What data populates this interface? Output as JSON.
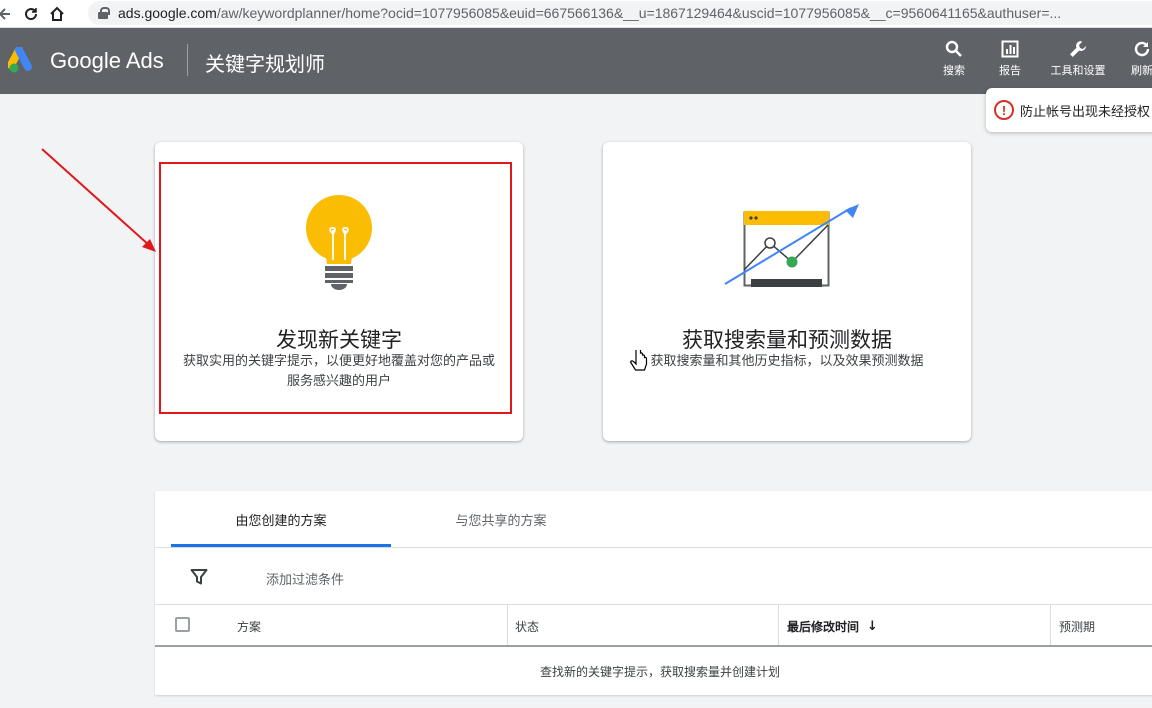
{
  "browser": {
    "url_host": "ads.google.com",
    "url_path": "/aw/keywordplanner/home?ocid=1077956085&euid=667566136&__u=1867129464&uscid=1077956085&__c=9560641165&authuser=..."
  },
  "header": {
    "brand": "Google Ads",
    "page_title": "关键字规划师",
    "actions": [
      {
        "label": "搜索",
        "icon": "search-icon"
      },
      {
        "label": "报告",
        "icon": "report-icon"
      },
      {
        "label": "工具和设置",
        "icon": "wrench-icon"
      },
      {
        "label": "刷新",
        "icon": "refresh-icon"
      }
    ]
  },
  "alert": {
    "text": "防止帐号出现未经授权"
  },
  "cards": [
    {
      "title": "发现新关键字",
      "description": "获取实用的关键字提示，以便更好地覆盖对您的产品或服务感兴趣的用户",
      "icon": "lightbulb-icon"
    },
    {
      "title": "获取搜索量和预测数据",
      "description": "获取搜索量和其他历史指标，以及效果预测数据",
      "icon": "trend-chart-icon"
    }
  ],
  "plans": {
    "tabs": [
      "由您创建的方案",
      "与您共享的方案"
    ],
    "active_tab": 0,
    "filter_label": "添加过滤条件",
    "columns": [
      "方案",
      "状态",
      "最后修改时间",
      "预测期"
    ],
    "sorted_column": "最后修改时间",
    "empty_message": "查找新的关键字提示，获取搜索量并创建计划"
  },
  "colors": {
    "header_bg": "#5f6368",
    "accent": "#1a73e8",
    "highlight": "#e0181b",
    "bulb": "#fbbc04"
  }
}
